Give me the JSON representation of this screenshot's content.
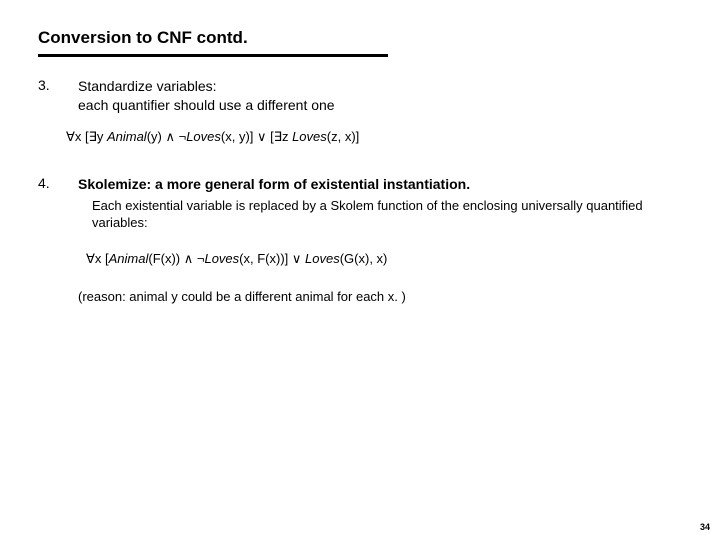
{
  "title": "Conversion to CNF contd.",
  "item3": {
    "num": "3.",
    "line1": "Standardize variables:",
    "line2": "each quantifier should use a different one",
    "formula_prefix": "∀x [∃y ",
    "formula_pred1": "Animal",
    "formula_mid1": "(y) ∧ ¬",
    "formula_pred2": "Loves",
    "formula_mid2": "(x, y)] ∨ [∃z ",
    "formula_pred3": "Loves",
    "formula_suffix": "(z, x)]"
  },
  "item4": {
    "num": "4.",
    "heading": "Skolemize: a more general form of existential instantiation.",
    "desc": "Each existential variable is replaced by a Skolem function of the enclosing universally quantified variables:",
    "formula_prefix": "∀x [",
    "formula_pred1": "Animal",
    "formula_mid1": "(F(x)) ∧ ¬",
    "formula_pred2": "Loves",
    "formula_mid2": "(x, F(x))] ∨ ",
    "formula_pred3": "Loves",
    "formula_suffix": "(G(x), x)",
    "reason": "(reason: animal y could be a different animal for each x. )"
  },
  "pagenum": "34"
}
